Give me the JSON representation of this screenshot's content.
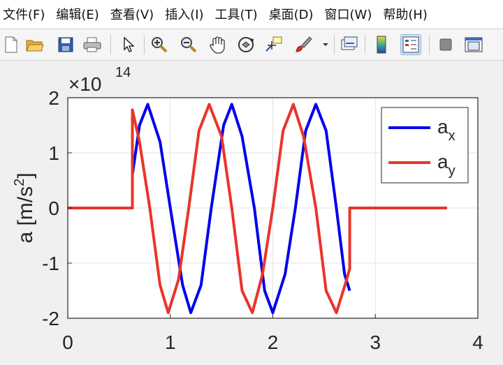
{
  "menu": [
    "文件(F)",
    "编辑(E)",
    "查看(V)",
    "插入(I)",
    "工具(T)",
    "桌面(D)",
    "窗口(W)",
    "帮助(H)"
  ],
  "toolbar": {
    "icons": [
      "new-file-icon",
      "open-folder-icon",
      "save-icon",
      "print-icon",
      "pointer-icon",
      "zoom-in-icon",
      "zoom-out-icon",
      "pan-hand-icon",
      "rotate-3d-icon",
      "data-cursor-icon",
      "brush-icon",
      "link-plot-icon",
      "colorbar-icon",
      "legend-icon",
      "hide-plot-tools-icon",
      "show-plot-tools-icon"
    ]
  },
  "colors": {
    "ax": "#0000ee",
    "ay": "#e8352a"
  },
  "chart_data": {
    "type": "line",
    "xlim": [
      0,
      4
    ],
    "ylim": [
      -2,
      2
    ],
    "xticks": [
      "0",
      "1",
      "2",
      "3",
      "4"
    ],
    "yticks": [
      "2",
      "1",
      "0",
      "-1",
      "-2"
    ],
    "exponent_label": "×10",
    "exponent_power": "14",
    "ylabel_main": "a  [m/s",
    "ylabel_sup": "2",
    "ylabel_end": "]",
    "grid": true,
    "legend_position": "top-right",
    "series": [
      {
        "name": "a",
        "name_sub": "x",
        "x": [
          0,
          0.63,
          0.63,
          0.7,
          0.78,
          0.9,
          1.0,
          1.12,
          1.2,
          1.3,
          1.4,
          1.52,
          1.6,
          1.7,
          1.82,
          1.92,
          2.0,
          2.12,
          2.22,
          2.32,
          2.42,
          2.52,
          2.62,
          2.7,
          2.75
        ],
        "y": [
          0,
          0,
          0.6,
          1.5,
          1.88,
          1.2,
          0,
          -1.4,
          -1.9,
          -1.4,
          0,
          1.5,
          1.88,
          1.3,
          0,
          -1.5,
          -1.9,
          -1.2,
          0,
          1.4,
          1.88,
          1.4,
          0,
          -1.2,
          -1.5
        ]
      },
      {
        "name": "a",
        "name_sub": "y",
        "x": [
          0,
          0.63,
          0.63,
          0.7,
          0.8,
          0.9,
          0.98,
          1.08,
          1.18,
          1.28,
          1.38,
          1.5,
          1.6,
          1.7,
          1.8,
          1.9,
          2.0,
          2.1,
          2.2,
          2.3,
          2.42,
          2.52,
          2.62,
          2.72,
          2.75,
          2.75,
          3.7
        ],
        "y": [
          0,
          0,
          1.78,
          1.2,
          0,
          -1.4,
          -1.9,
          -1.3,
          0,
          1.4,
          1.88,
          1.3,
          0,
          -1.5,
          -1.9,
          -1.2,
          0,
          1.4,
          1.88,
          1.3,
          0,
          -1.5,
          -1.9,
          -1.3,
          -1.1,
          0,
          0
        ]
      }
    ]
  }
}
